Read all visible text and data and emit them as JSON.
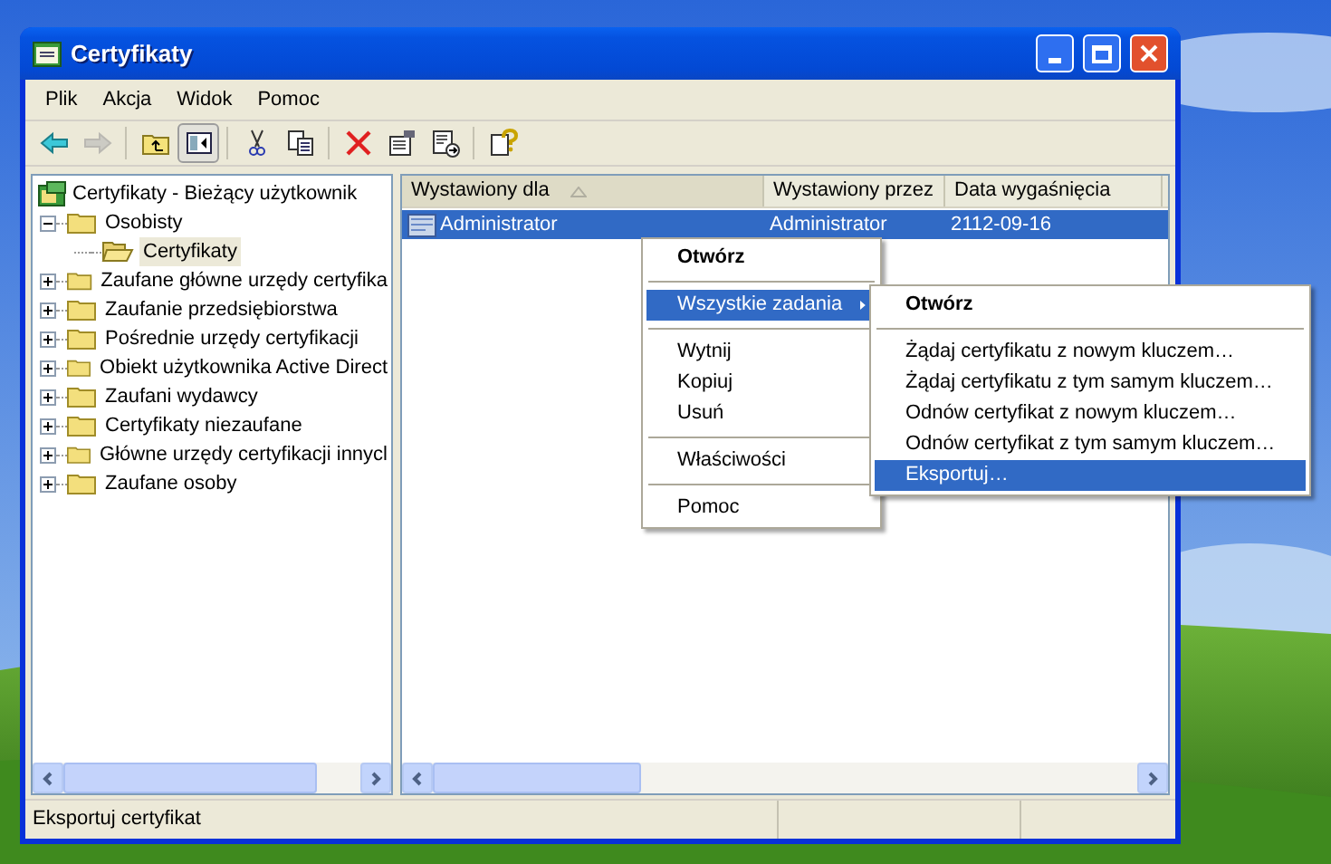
{
  "window": {
    "title": "Certyfikaty"
  },
  "menu_bar": [
    {
      "label": "Plik"
    },
    {
      "label": "Akcja"
    },
    {
      "label": "Widok"
    },
    {
      "label": "Pomoc"
    }
  ],
  "toolbar": [
    {
      "kind": "back",
      "disabled": false,
      "pressed": false
    },
    {
      "kind": "forward",
      "disabled": true,
      "pressed": false
    },
    {
      "kind": "separator"
    },
    {
      "kind": "up",
      "disabled": false,
      "pressed": false
    },
    {
      "kind": "tree",
      "disabled": false,
      "pressed": true
    },
    {
      "kind": "separator"
    },
    {
      "kind": "cut",
      "disabled": false,
      "pressed": false
    },
    {
      "kind": "copy",
      "disabled": false,
      "pressed": false
    },
    {
      "kind": "separator"
    },
    {
      "kind": "delete",
      "disabled": false,
      "pressed": false
    },
    {
      "kind": "properties",
      "disabled": false,
      "pressed": false
    },
    {
      "kind": "export",
      "disabled": false,
      "pressed": false
    },
    {
      "kind": "separator"
    },
    {
      "kind": "help",
      "disabled": false,
      "pressed": false
    }
  ],
  "tree": {
    "label": "Certyfikaty - Bieżący użytkownik",
    "children": [
      {
        "label": "Osobisty",
        "expanded": true,
        "selected": false,
        "children": [
          {
            "label": "Certyfikaty",
            "selected": true
          }
        ]
      },
      {
        "label": "Zaufane główne urzędy certyfika",
        "expanded": false,
        "selected": false
      },
      {
        "label": "Zaufanie przedsiębiorstwa",
        "expanded": false,
        "selected": false
      },
      {
        "label": "Pośrednie urzędy certyfikacji",
        "expanded": false,
        "selected": false
      },
      {
        "label": "Obiekt użytkownika Active Direct",
        "expanded": false,
        "selected": false
      },
      {
        "label": "Zaufani wydawcy",
        "expanded": false,
        "selected": false
      },
      {
        "label": "Certyfikaty niezaufane",
        "expanded": false,
        "selected": false
      },
      {
        "label": "Główne urzędy certyfikacji innycl",
        "expanded": false,
        "selected": false
      },
      {
        "label": "Zaufane osoby",
        "expanded": false,
        "selected": false
      }
    ]
  },
  "table": {
    "columns": [
      {
        "label": "Wystawiony dla",
        "sorted": true
      },
      {
        "label": "Wystawiony przez",
        "sorted": false
      },
      {
        "label": "Data wygaśnięcia",
        "sorted": false
      }
    ],
    "rows": [
      {
        "cells": [
          "Administrator",
          "Administrator",
          "2112-09-16"
        ],
        "selected": true
      }
    ]
  },
  "context_menu": [
    {
      "kind": "item",
      "label": "Otwórz",
      "bold": true,
      "highlighted": false,
      "submenu": false
    },
    {
      "kind": "separator"
    },
    {
      "kind": "item",
      "label": "Wszystkie zadania",
      "bold": false,
      "highlighted": true,
      "submenu": true
    },
    {
      "kind": "separator"
    },
    {
      "kind": "item",
      "label": "Wytnij",
      "bold": false,
      "highlighted": false,
      "submenu": false
    },
    {
      "kind": "item",
      "label": "Kopiuj",
      "bold": false,
      "highlighted": false,
      "submenu": false
    },
    {
      "kind": "item",
      "label": "Usuń",
      "bold": false,
      "highlighted": false,
      "submenu": false
    },
    {
      "kind": "separator"
    },
    {
      "kind": "item",
      "label": "Właściwości",
      "bold": false,
      "highlighted": false,
      "submenu": false
    },
    {
      "kind": "separator"
    },
    {
      "kind": "item",
      "label": "Pomoc",
      "bold": false,
      "highlighted": false,
      "submenu": false
    }
  ],
  "submenu": [
    {
      "kind": "item",
      "label": "Otwórz",
      "bold": true,
      "highlighted": false,
      "submenu": false
    },
    {
      "kind": "separator"
    },
    {
      "kind": "item",
      "label": "Żądaj certyfikatu z nowym kluczem…",
      "bold": false,
      "highlighted": false,
      "submenu": false
    },
    {
      "kind": "item",
      "label": "Żądaj certyfikatu z tym samym kluczem…",
      "bold": false,
      "highlighted": false,
      "submenu": false
    },
    {
      "kind": "item",
      "label": "Odnów certyfikat z nowym kluczem…",
      "bold": false,
      "highlighted": false,
      "submenu": false
    },
    {
      "kind": "item",
      "label": "Odnów certyfikat z tym samym kluczem…",
      "bold": false,
      "highlighted": false,
      "submenu": false
    },
    {
      "kind": "item",
      "label": "Eksportuj…",
      "bold": false,
      "highlighted": true,
      "submenu": false
    }
  ],
  "status_bar": {
    "text": "Eksportuj certyfikat"
  }
}
